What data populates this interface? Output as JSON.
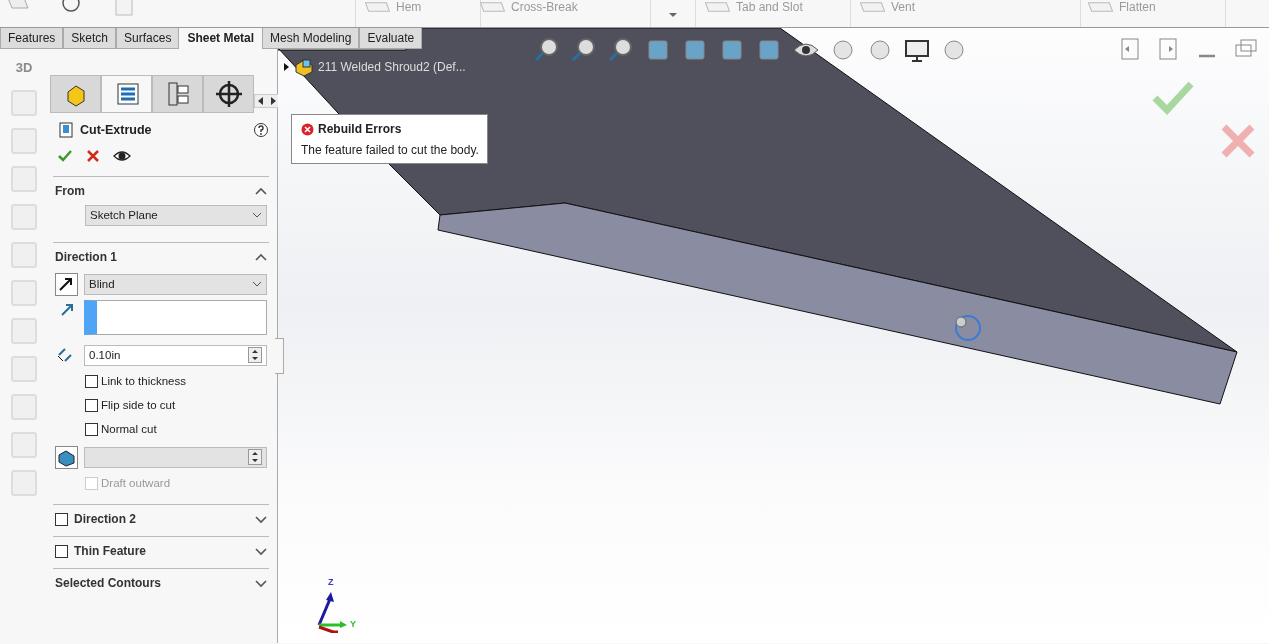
{
  "ribbon": {
    "commands": [
      {
        "label": "Hem"
      },
      {
        "label": "Cross-Break"
      },
      {
        "label": "Tab and Slot"
      },
      {
        "label": "Vent"
      },
      {
        "label": "Flatten"
      }
    ]
  },
  "tabs": [
    {
      "label": "Features",
      "selected": false
    },
    {
      "label": "Sketch",
      "selected": false
    },
    {
      "label": "Surfaces",
      "selected": false
    },
    {
      "label": "Sheet Metal",
      "selected": true
    },
    {
      "label": "Mesh Modeling",
      "selected": false
    },
    {
      "label": "Evaluate",
      "selected": false
    }
  ],
  "side_toolbar": {
    "badge": "3D"
  },
  "property_tabs": [
    {
      "selected": false
    },
    {
      "selected": true
    },
    {
      "selected": false
    },
    {
      "selected": false
    }
  ],
  "panel": {
    "title": "Cut-Extrude",
    "sections": [
      {
        "kind": "from",
        "title": "From",
        "expanded": true,
        "value": "Sketch Plane"
      },
      {
        "kind": "direction",
        "title": "Direction 1",
        "expanded": true,
        "end_condition": "Blind",
        "depth": "0.10in",
        "options": [
          {
            "label": "Link to thickness",
            "checked": false
          },
          {
            "label": "Flip side to cut",
            "checked": false
          },
          {
            "label": "Normal cut",
            "checked": false
          }
        ],
        "draft": {
          "label": "Draft outward",
          "checked": false,
          "disabled": true
        }
      },
      {
        "kind": "toggle",
        "title": "Direction 2",
        "expanded": false,
        "checked": false
      },
      {
        "kind": "toggle",
        "title": "Thin Feature",
        "expanded": false,
        "checked": false
      },
      {
        "kind": "plain",
        "title": "Selected Contours",
        "expanded": false
      }
    ]
  },
  "tree": {
    "label": "211 Welded Shroud2  (Def...",
    "expanded": false
  },
  "tooltip": {
    "title": "Rebuild Errors",
    "message": "The feature failed to cut the body."
  },
  "triad": {
    "z": "Z",
    "y": "Y"
  }
}
